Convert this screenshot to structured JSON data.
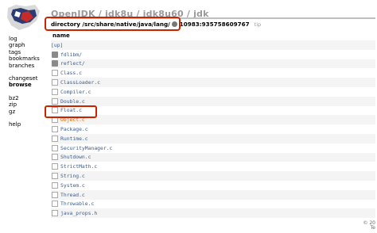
{
  "sidebar": {
    "group1": [
      "log",
      "graph",
      "tags",
      "bookmarks",
      "branches"
    ],
    "group2": [
      "changeset",
      "browse"
    ],
    "group3": [
      "bz2",
      "zip",
      "gz"
    ],
    "group4": [
      "help"
    ]
  },
  "header": {
    "title": "OpenJDK / jdk8u / jdk8u60 / jdk",
    "path": "directory /src/share/native/java/lang/",
    "revision": "10983:935758609767",
    "tip": "tip"
  },
  "table": {
    "column_name": "name",
    "rows": [
      {
        "name": "[up]",
        "icon": "none"
      },
      {
        "name": "fdlibm/",
        "icon": "folder-icon"
      },
      {
        "name": "reflect/",
        "icon": "folder-icon"
      },
      {
        "name": "Class.c",
        "icon": "file-icon"
      },
      {
        "name": "ClassLoader.c",
        "icon": "file-icon"
      },
      {
        "name": "Compiler.c",
        "icon": "file-icon"
      },
      {
        "name": "Double.c",
        "icon": "file-icon"
      },
      {
        "name": "Float.c",
        "icon": "file-icon"
      },
      {
        "name": "Object.c",
        "icon": "file-icon"
      },
      {
        "name": "Package.c",
        "icon": "file-icon"
      },
      {
        "name": "Runtime.c",
        "icon": "file-icon"
      },
      {
        "name": "SecurityManager.c",
        "icon": "file-icon"
      },
      {
        "name": "Shutdown.c",
        "icon": "file-icon"
      },
      {
        "name": "StrictMath.c",
        "icon": "file-icon"
      },
      {
        "name": "String.c",
        "icon": "file-icon"
      },
      {
        "name": "System.c",
        "icon": "file-icon"
      },
      {
        "name": "Thread.c",
        "icon": "file-icon"
      },
      {
        "name": "Throwable.c",
        "icon": "file-icon"
      },
      {
        "name": "java_props.h",
        "icon": "file-icon"
      }
    ]
  },
  "footer": {
    "line1": "© 20",
    "line2": "Te"
  },
  "colors": {
    "link": "#3d5c88",
    "highlight_box": "#cc2200",
    "highlight_link": "#d06a12"
  }
}
